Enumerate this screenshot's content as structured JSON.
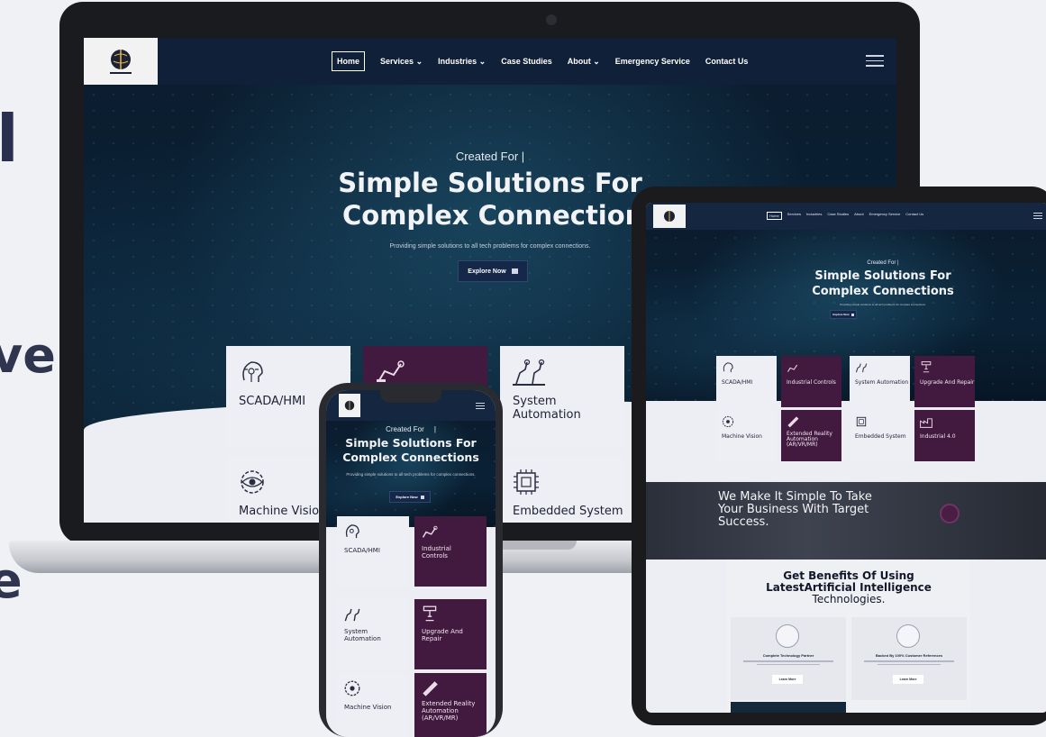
{
  "nav": {
    "home": "Home",
    "services": "Services",
    "industries": "Industries",
    "case_studies": "Case Studies",
    "about": "About",
    "emergency": "Emergency Service",
    "contact": "Contact Us"
  },
  "hero": {
    "created_for": "Created For |",
    "created_for_phone": "Created For     |",
    "headline_1": "Simple Solutions For",
    "headline_2": "Complex Connections",
    "headline_2_laptop": "Complex Connection",
    "subtitle": "Providing simple solutions to all tech problems for complex connections.",
    "explore": "Explore Now"
  },
  "services": {
    "scada": "SCADA/HMI",
    "industrial_controls": "Industrial Controls",
    "system_automation": "System Automation",
    "upgrade_repair": "Upgrade And Repair",
    "machine_vision": "Machine Vision",
    "xr": "Extended Reality Automation (AR/VR/MR)",
    "embedded": "Embedded System",
    "industrial_40": "Industrial 4.0"
  },
  "banner": {
    "text": "We Make It Simple To Take Your Business With Target Success."
  },
  "benefits": {
    "title_1": "Get Benefits Of Using",
    "title_2": "LatestArtificial Intelligence",
    "title_3": "Technologies.",
    "card_1_title": "Complete Technology Partner",
    "card_2_title": "Backed By 100% Customer References",
    "learn_more": "Learn More"
  },
  "edge_letters": [
    "l",
    "ve",
    "e"
  ],
  "colors": {
    "navy": "#102038",
    "plum": "#42193f",
    "light_tile": "#eeeef5",
    "background": "#f0f1f5"
  }
}
